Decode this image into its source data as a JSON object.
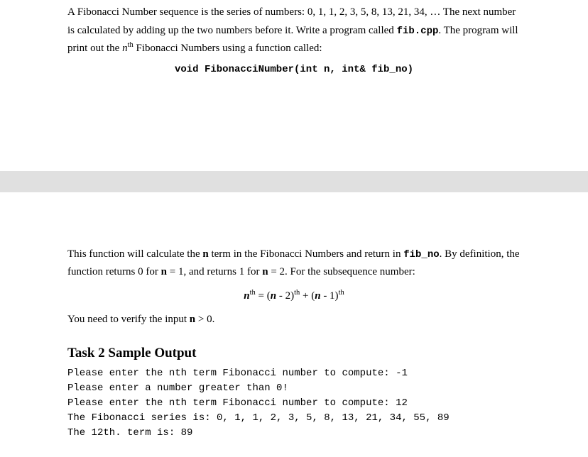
{
  "block1": {
    "p1_a": "A Fibonacci Number sequence is the series of numbers: 0, 1, 1, 2, 3, 5, 8, 13, 21, 34, …  The next number is calculated by adding up the two numbers before it. Write a program called ",
    "p1_code1": "fib.cpp",
    "p1_b": ".  The program will print out the ",
    "p1_n": "n",
    "p1_th": "th",
    "p1_c": " Fibonacci Numbers using a function called:",
    "func_sig": "void FibonacciNumber(int n, int& fib_no)"
  },
  "block2": {
    "p2_a": "This function will calculate the ",
    "p2_n1": "n",
    "p2_b": " term in the Fibonacci Numbers and return in ",
    "p2_code1": "fib_no",
    "p2_c": ".  By definition, the function returns 0 for ",
    "p2_n2": "n",
    "p2_d": " = 1, and returns 1 for ",
    "p2_n3": "n",
    "p2_e": " = 2.  For the subsequence number:",
    "formula_n": "n",
    "formula_th1": "th",
    "formula_eq": " = (",
    "formula_n2": "n",
    "formula_m2": " - 2)",
    "formula_th2": "th",
    "formula_plus": " + (",
    "formula_n3": "n",
    "formula_m1": " - 1)",
    "formula_th3": "th",
    "p3_a": "You need to verify the input ",
    "p3_n": "n",
    "p3_b": " > 0.",
    "heading": "Task 2 Sample Output",
    "out1": "Please enter the nth term Fibonacci number to compute: -1",
    "out2": "Please enter a number greater than 0!",
    "out3": "Please enter the nth term Fibonacci number to compute: 12",
    "out4": "The Fibonacci series is: 0, 1, 1, 2, 3, 5, 8, 13, 21, 34, 55, 89",
    "out5": "The 12th. term is: 89"
  }
}
